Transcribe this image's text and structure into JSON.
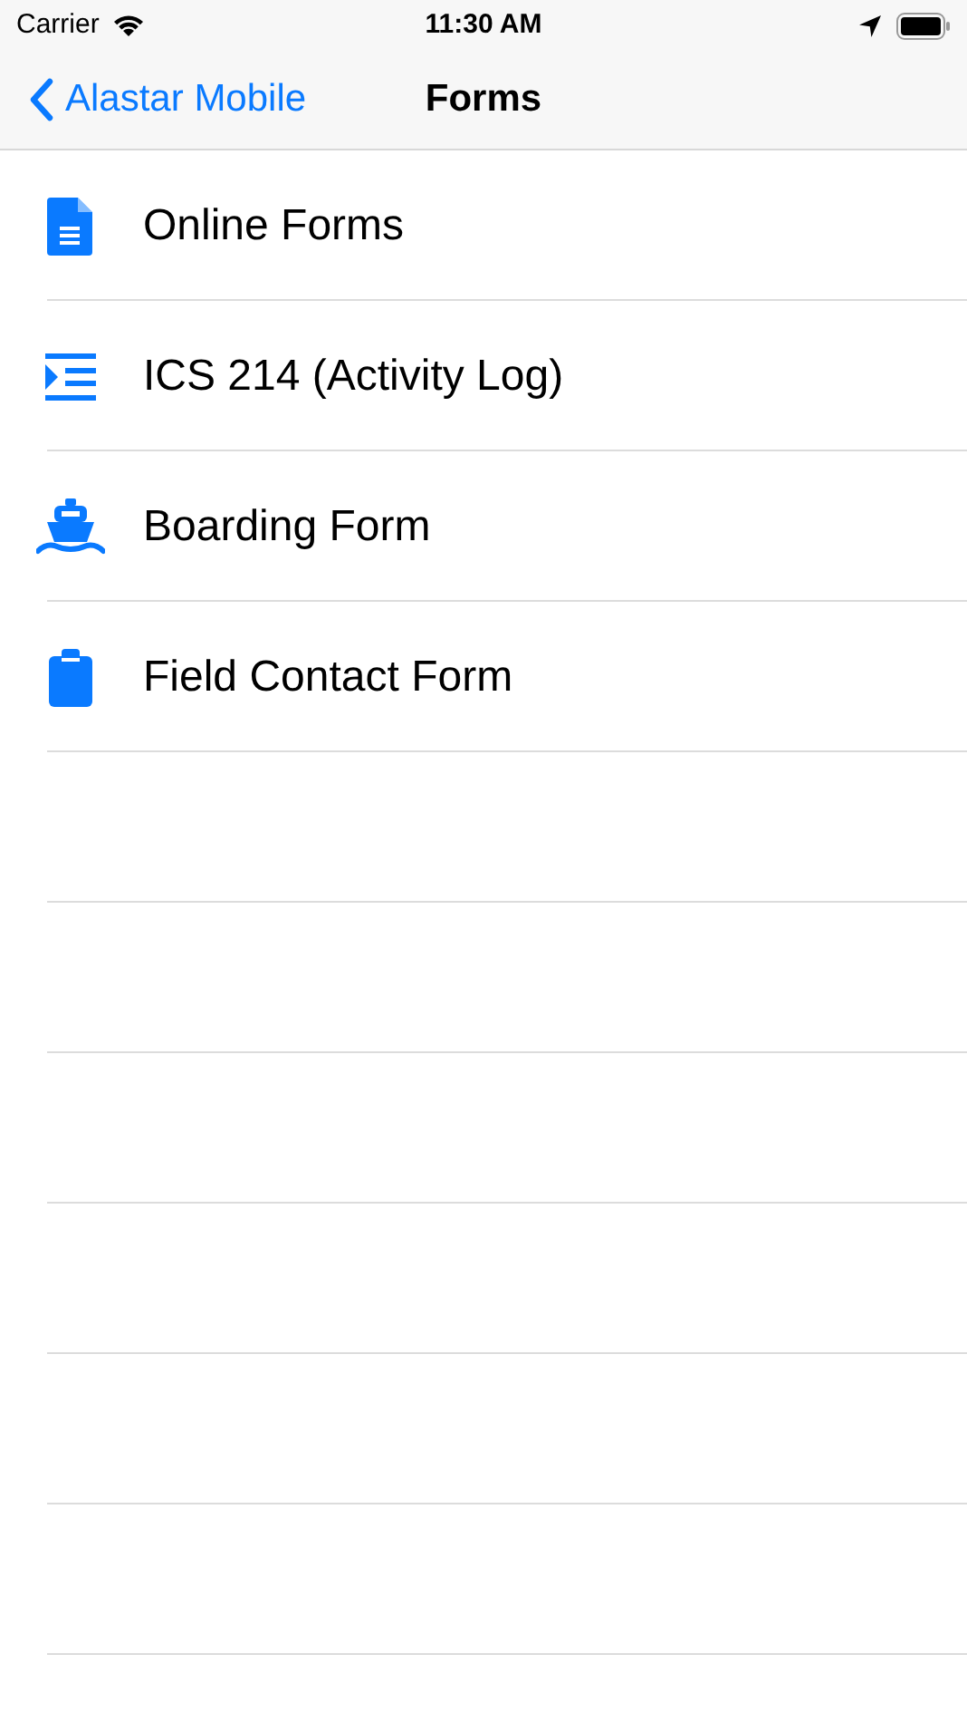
{
  "status_bar": {
    "carrier": "Carrier",
    "time": "11:30 AM"
  },
  "nav_bar": {
    "back_label": "Alastar Mobile",
    "title": "Forms"
  },
  "items": [
    {
      "label": "Online Forms",
      "kind": "document"
    },
    {
      "label": "ICS 214 (Activity Log)",
      "kind": "indent-list"
    },
    {
      "label": "Boarding Form",
      "kind": "ship"
    },
    {
      "label": "Field Contact Form",
      "kind": "clipboard"
    }
  ]
}
